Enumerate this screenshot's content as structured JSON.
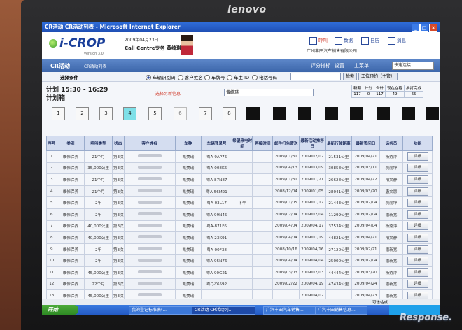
{
  "monitor": {
    "brand": "lenovo"
  },
  "window": {
    "title": "CR活动 CR活动列表 - Microsoft Internet Explorer"
  },
  "header": {
    "logo": "i-CROP",
    "version": "version 3.0",
    "date": "2009年04月23日",
    "dept": "Call Centre专务",
    "user": "黄绮琪",
    "links": [
      "呼叫",
      "数据",
      "日历",
      "消息"
    ],
    "company": "广州丰田汽车销售有限公司"
  },
  "nav": {
    "left": "CR活动",
    "sub": "CR活动列表",
    "items": [
      "评分指标",
      "设置",
      "主菜单"
    ],
    "select": "快速连接"
  },
  "search": {
    "label": "选择条件",
    "options": [
      "车辆识别码",
      "客户姓名",
      "车牌号",
      "车主 ID",
      "电话号码"
    ],
    "search_button": "检索",
    "work_button": "工位预约（主管）"
  },
  "plan": {
    "line1": "计划 15:30 - 16:29",
    "line2": "计划箱",
    "link": "选择另新信息",
    "dropdown": "黄绮琪",
    "stat_headers": [
      "新期",
      "计划",
      "合计",
      "现在在程",
      "推打完成"
    ],
    "stat_values": [
      "117",
      "0",
      "117",
      "49",
      "65"
    ],
    "slots": [
      "1",
      "2",
      "3",
      "4",
      "5",
      "6",
      "7",
      "8",
      "",
      "",
      "",
      "",
      "",
      "",
      "",
      ""
    ]
  },
  "table": {
    "headers": [
      "序号",
      "类别",
      "呼叫类型",
      "状态",
      "客户姓名",
      "车种",
      "车辆登录号",
      "希望来电时间",
      "再接时间",
      "邮件打告寄送",
      "最新活动推移日",
      "最新行驶距离",
      "最新签问日",
      "话务员",
      "功能"
    ],
    "rows": [
      [
        "1",
        "维修保养",
        "21个月",
        "第3次",
        "",
        "凯美瑞",
        "粤A-9AP76",
        "",
        "",
        "2009/01/31",
        "2009/02/02",
        "21531公里",
        "2009/04/21",
        "杨秀萍",
        "详细"
      ],
      [
        "2",
        "维修保养",
        "35,000公里",
        "第3次",
        "",
        "凯美瑞",
        "粤A-008K6",
        "",
        "",
        "2009/04/13",
        "2009/03/09",
        "30858公里",
        "2009/03/11",
        "冼丽坤",
        "详细"
      ],
      [
        "3",
        "维修保养",
        "21个月",
        "第3次",
        "",
        "凯美瑞",
        "粤A-87N87",
        "",
        "",
        "2009/01/31",
        "2009/01/21",
        "26628公里",
        "2009/04/22",
        "阳文静",
        "详细"
      ],
      [
        "4",
        "维修保养",
        "21个月",
        "第3次",
        "",
        "凯美瑞",
        "粤A-56M21",
        "",
        "",
        "2008/12/04",
        "2009/01/05",
        "28041公里",
        "2009/03/20",
        "唐文惠",
        "详细"
      ],
      [
        "5",
        "维修保养",
        "2年",
        "第3次",
        "",
        "凯美瑞",
        "粤A-03L17",
        "下午",
        "",
        "2009/01/05",
        "2009/01/17",
        "21443公里",
        "2009/02/04",
        "冼丽坤",
        "详细"
      ],
      [
        "6",
        "维修保养",
        "2年",
        "第3次",
        "",
        "凯美瑞",
        "粤A-99N45",
        "",
        "",
        "2009/02/04",
        "2009/02/04",
        "11299公里",
        "2009/02/04",
        "潘新宽",
        "详细"
      ],
      [
        "7",
        "维修保养",
        "40,000公里",
        "第3次",
        "",
        "凯美瑞",
        "粤A-871F6",
        "",
        "",
        "2009/04/04",
        "2009/04/17",
        "37534公里",
        "2009/04/04",
        "杨秀萍",
        "详细"
      ],
      [
        "8",
        "维修保养",
        "40,000公里",
        "第3次",
        "",
        "凯美瑞",
        "粤A-23K91",
        "",
        "",
        "2009/04/04",
        "2009/01/19",
        "44821公里",
        "2009/04/21",
        "阳文静",
        "详细"
      ],
      [
        "9",
        "维修保养",
        "2年",
        "第3次",
        "",
        "凯美瑞",
        "粤A-00F38",
        "",
        "",
        "2008/10/16",
        "2009/04/16",
        "27120公里",
        "2009/02/21",
        "潘新宽",
        "详细"
      ],
      [
        "10",
        "维修保养",
        "2年",
        "第3次",
        "",
        "凯美瑞",
        "粤A-95N76",
        "",
        "",
        "2009/04/04",
        "2009/04/04",
        "25000公里",
        "2009/02/04",
        "潘新宽",
        "详细"
      ],
      [
        "11",
        "维修保养",
        "45,000公里",
        "第3次",
        "",
        "凯美瑞",
        "粤A-90G21",
        "",
        "",
        "2009/03/03",
        "2009/02/03",
        "44444公里",
        "2009/03/20",
        "杨秀萍",
        "详细"
      ],
      [
        "12",
        "维修保养",
        "22个月",
        "第3次",
        "",
        "凯美瑞",
        "粤Q-Y6592",
        "",
        "",
        "2009/02/22",
        "2009/04/19",
        "47434公里",
        "2009/04/24",
        "潘新宽",
        "详细"
      ],
      [
        "13",
        "维修保养",
        "45,000公里",
        "第3次",
        "",
        "凯美瑞",
        "",
        "",
        "",
        "",
        "2009/04/02",
        "",
        "2009/04/23",
        "潘新宽",
        "详细"
      ]
    ]
  },
  "status": {
    "text": "可信站点"
  },
  "taskbar": {
    "start": "开始",
    "tasks": [
      "我的登记标准表(...",
      "CR活动 CR活动列...",
      "广汽丰田汽车销售...",
      "广汽丰田销售信息..."
    ]
  },
  "watermark": "Response."
}
